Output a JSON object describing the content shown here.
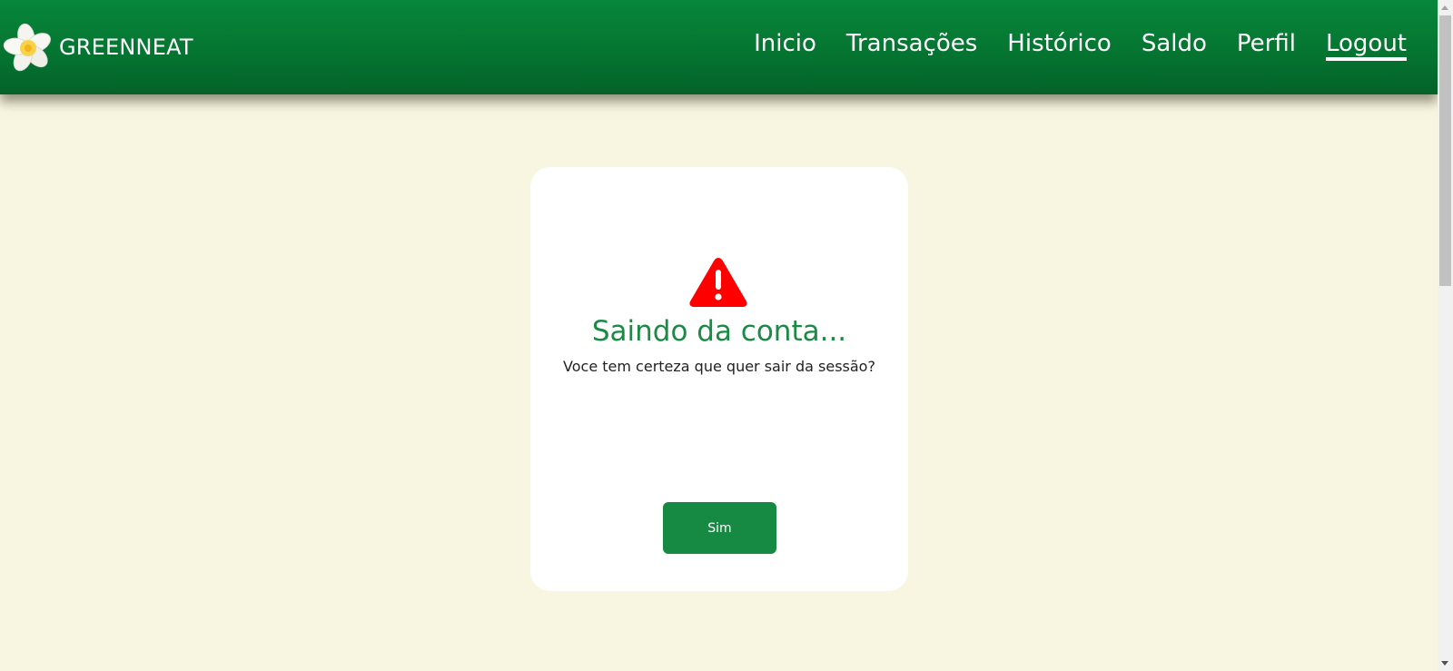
{
  "brand": {
    "name": "GREENNEAT",
    "logo_icon": "plumeria-flower-icon"
  },
  "nav": {
    "items": [
      {
        "label": "Inicio"
      },
      {
        "label": "Transações"
      },
      {
        "label": "Histórico"
      },
      {
        "label": "Saldo"
      },
      {
        "label": "Perfil"
      },
      {
        "label": "Logout",
        "active": true
      }
    ]
  },
  "dialog": {
    "icon": "warning-icon",
    "title": "Saindo da conta...",
    "message": "Voce tem certeza que quer sair da sessão?",
    "confirm_label": "Sim"
  },
  "colors": {
    "header_green": "#057531",
    "background": "#f8f6e1",
    "title_green": "#1a8a45",
    "button_green": "#168a43",
    "warning_red": "#ff0000"
  }
}
